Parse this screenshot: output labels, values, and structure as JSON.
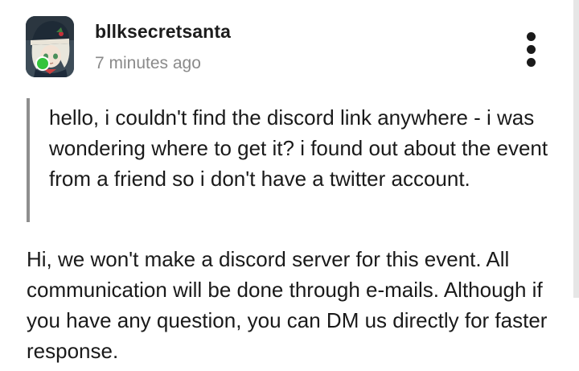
{
  "post": {
    "username": "bllksecretsanta",
    "timestamp": "7 minutes ago",
    "avatar_icon": "anime-avatar",
    "online_status": "online",
    "more_icon": "more-vertical-icon",
    "quoted_text": "hello, i couldn't find the discord link anywhere - i was wondering where to get it? i found out about the event from a friend so i don't have a twitter account.",
    "reply_text": "Hi, we won't make a discord server for this event. All communication will be done through e-mails. Although if you have any question, you can DM us directly for faster response."
  },
  "colors": {
    "online": "#34c43b",
    "quote_bar": "#8f8f8f",
    "timestamp": "#8a8a8a",
    "text": "#1a1a1a"
  }
}
